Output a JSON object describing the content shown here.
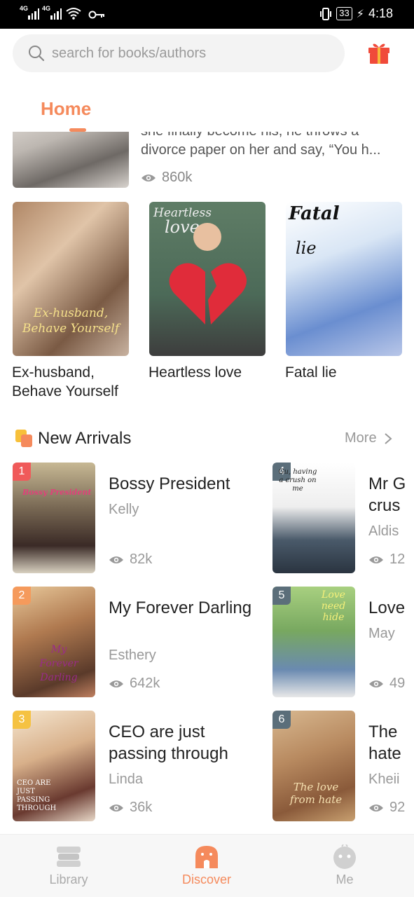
{
  "status_bar": {
    "net1": "4G",
    "net2": "4G",
    "battery": "33",
    "time": "4:18"
  },
  "search": {
    "placeholder": "search for books/authors"
  },
  "tabs": {
    "home": "Home"
  },
  "top_book": {
    "description": "she finally become his, he throws a divorce paper on her and say, “You h...",
    "views": "860k"
  },
  "featured": [
    {
      "title": "Ex-husband, Behave Yourself",
      "cover_text": "Ex-husband, Behave Yourself"
    },
    {
      "title": "Heartless love",
      "cover_text_1": "Heartless",
      "cover_text_2": "love"
    },
    {
      "title": "Fatal lie",
      "cover_text_1": "Fatal",
      "cover_text_2": "lie"
    }
  ],
  "new_arrivals": {
    "title": "New Arrivals",
    "more": "More",
    "items": [
      {
        "rank": "1",
        "title": "Bossy President",
        "author": "Kelly",
        "views": "82k",
        "cover_text": "Bossy President",
        "rank_color": "#f05a5a"
      },
      {
        "rank": "2",
        "title": "My Forever Darling",
        "author": "Esthery",
        "views": "642k",
        "cover_text": "My Forever Darling",
        "rank_color": "#f59a5c"
      },
      {
        "rank": "3",
        "title": "CEO are just passing through",
        "author": "Linda",
        "views": "36k",
        "cover_text": "CEO ARE JUST PASSING THROUGH",
        "rank_color": "#f5c242"
      },
      {
        "rank": "4",
        "title": "Mr G crus",
        "author": "Aldis",
        "views": "12",
        "cover_text": "Gu, having a crush on me",
        "rank_color": "#5b6e7a"
      },
      {
        "rank": "5",
        "title": "Love",
        "author": "May",
        "views": "49",
        "cover_text": "Love need hide",
        "rank_color": "#5b6e7a"
      },
      {
        "rank": "6",
        "title": "The hate",
        "author": "Kheii",
        "views": "92",
        "cover_text": "The love from hate",
        "rank_color": "#5b6e7a"
      }
    ]
  },
  "bottom_nav": {
    "library": "Library",
    "discover": "Discover",
    "me": "Me"
  },
  "colors": {
    "accent": "#f58a5c",
    "muted": "#999999"
  }
}
